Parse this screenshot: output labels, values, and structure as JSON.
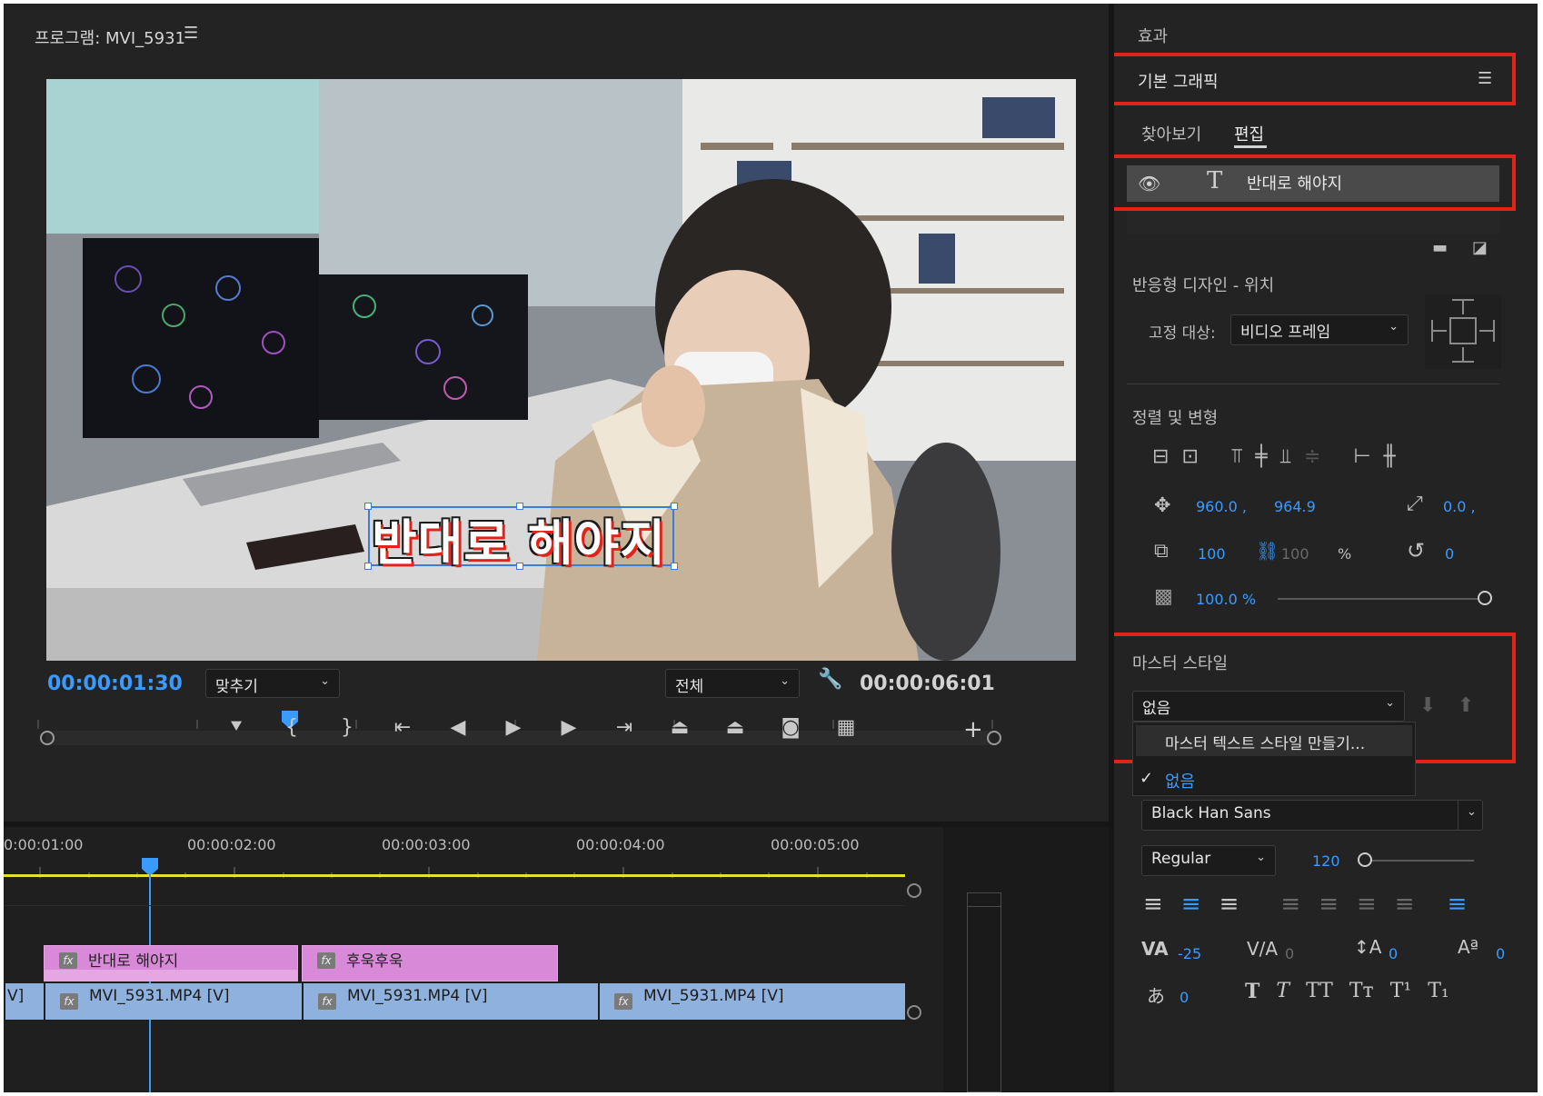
{
  "program": {
    "title": "프로그램: MVI_5931",
    "overlay_text": "반대로 해야지",
    "current_time": "00:00:01:30",
    "fit_dropdown": "맞추기",
    "quality_dropdown": "전체",
    "duration": "00:00:06:01"
  },
  "effects_panel": {
    "tab_effects": "효과",
    "panel_title": "기본 그래픽",
    "tab_browse": "찾아보기",
    "tab_edit": "편집",
    "layer_name": "반대로 해야지",
    "responsive_title": "반응형 디자인 - 위치",
    "pin_label": "고정 대상:",
    "pin_value": "비디오 프레임",
    "align_title": "정렬 및 변형",
    "position_x": "960.0 ,",
    "position_y": "964.9",
    "anchor_x": "0.0 ,",
    "scale": "100",
    "scale_linked": "100",
    "scale_unit": "%",
    "rotation": "0",
    "opacity": "100.0 %",
    "master_style_title": "마스터 스타일",
    "master_style_value": "없음",
    "menu_create": "마스터 텍스트 스타일 만들기...",
    "menu_none": "없음",
    "font_family": "Black Han Sans",
    "font_style": "Regular",
    "font_size": "120",
    "kerning": "-25",
    "tracking": "0",
    "leading": "0",
    "baseline": "0",
    "tsume": "0"
  },
  "timeline": {
    "ruler": [
      "0:00:01:00",
      "00:00:02:00",
      "00:00:03:00",
      "00:00:04:00",
      "00:00:05:00"
    ],
    "graphics_clips": [
      "반대로 해야지",
      "후욱후욱"
    ],
    "video_clips": [
      "MVI_5931.MP4 [V]",
      "MVI_5931.MP4 [V]",
      "MVI_5931.MP4 [V]"
    ],
    "v_prefix": "V]",
    "fx_label": "fx"
  },
  "colors": {
    "accent": "#3a9bff",
    "highlight_red": "#e2231a",
    "clip_pink": "#d889d7",
    "clip_blue": "#8fb1dd"
  }
}
